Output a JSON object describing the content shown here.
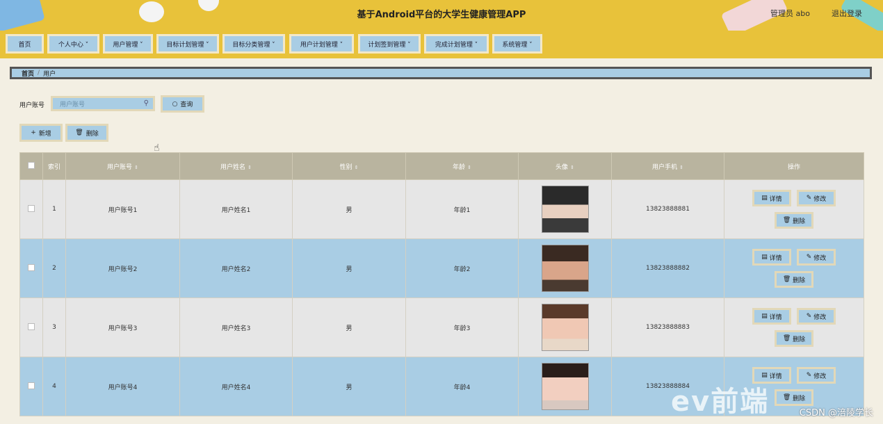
{
  "header": {
    "title": "基于Android平台的大学生健康管理APP",
    "admin_label": "管理员 abo",
    "logout_label": "退出登录"
  },
  "nav": [
    {
      "label": "首页"
    },
    {
      "label": "个人中心 ˅"
    },
    {
      "label": "用户管理 ˅"
    },
    {
      "label": "目标计划管理 ˅"
    },
    {
      "label": "目标分类管理 ˅"
    },
    {
      "label": "用户计划管理 ˅"
    },
    {
      "label": "计划签到管理 ˅"
    },
    {
      "label": "完成计划管理 ˅"
    },
    {
      "label": "系统管理 ˅"
    }
  ],
  "breadcrumb": {
    "home": "首页",
    "separator": "/",
    "current": "用户"
  },
  "search": {
    "label": "用户账号",
    "placeholder": "用户账号",
    "button": "查询"
  },
  "actions": {
    "add": "新增",
    "delete": "删除"
  },
  "table": {
    "columns": [
      "索引",
      "用户账号",
      "用户姓名",
      "性别",
      "年龄",
      "头像",
      "用户手机",
      "操作"
    ],
    "rows": [
      {
        "index": "1",
        "account": "用户账号1",
        "name": "用户姓名1",
        "gender": "男",
        "age": "年龄1",
        "phone": "13823888881"
      },
      {
        "index": "2",
        "account": "用户账号2",
        "name": "用户姓名2",
        "gender": "男",
        "age": "年龄2",
        "phone": "13823888882"
      },
      {
        "index": "3",
        "account": "用户账号3",
        "name": "用户姓名3",
        "gender": "男",
        "age": "年龄3",
        "phone": "13823888883"
      },
      {
        "index": "4",
        "account": "用户账号4",
        "name": "用户姓名4",
        "gender": "男",
        "age": "年龄4",
        "phone": "13823888884"
      }
    ],
    "row_actions": {
      "detail": "详情",
      "edit": "修改",
      "delete": "删除"
    }
  },
  "watermark": {
    "brand": "ev前端",
    "credit": "CSDN @涪陵学长"
  },
  "colors": {
    "topbar": "#e8c23a",
    "button": "#a9cde4",
    "header_row": "#b9b49f",
    "page_bg": "#f3efe3"
  }
}
